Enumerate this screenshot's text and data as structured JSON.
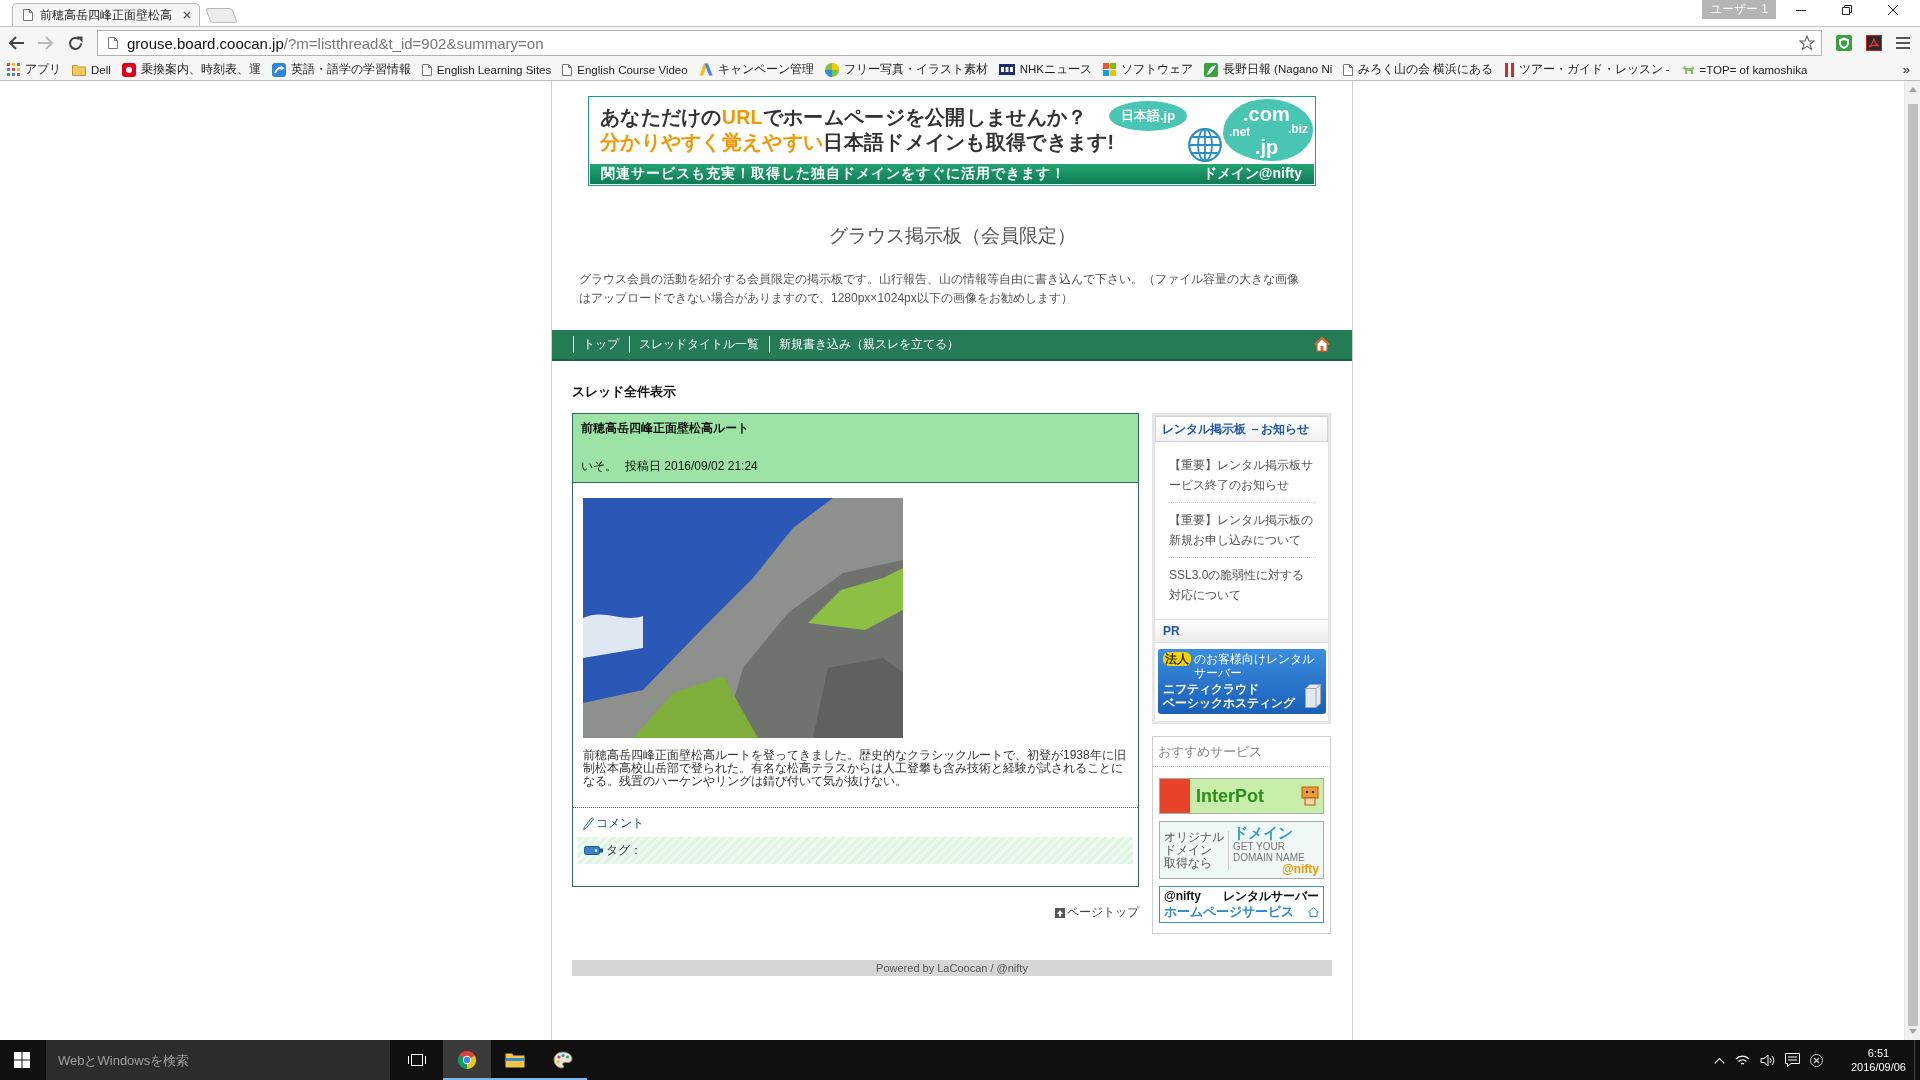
{
  "browser": {
    "tabs": [
      {
        "title": "前穂高岳四峰正面壁松高",
        "selected": true
      }
    ],
    "profile": "ユーザー 1",
    "address": {
      "host": "grouse.board.coocan.jp",
      "path": "/?m=listthread&t_id=902&summary=on"
    },
    "bookmarks": [
      {
        "label": "アプリ",
        "kind": "apps"
      },
      {
        "label": "Dell",
        "kind": "folder"
      },
      {
        "label": "乗換案内、時刻表、運",
        "kind": "yahoo"
      },
      {
        "label": "英語・語学の学習情報",
        "kind": "arrow"
      },
      {
        "label": "English Learning Sites",
        "kind": "page"
      },
      {
        "label": "English Course Video",
        "kind": "page"
      },
      {
        "label": "キャンペーン管理",
        "kind": "adwords"
      },
      {
        "label": "フリー写真・イラスト素材",
        "kind": "ball"
      },
      {
        "label": "NHKニュース",
        "kind": "nhk"
      },
      {
        "label": "ソフトウェア",
        "kind": "windows"
      },
      {
        "label": "長野日報 (Nagano Ni",
        "kind": "leaf"
      },
      {
        "label": "みろく山の会 横浜にある",
        "kind": "page"
      },
      {
        "label": "ツアー・ガイド・レッスン -",
        "kind": "bars"
      },
      {
        "label": "=TOP= of kamoshika",
        "kind": "goat"
      }
    ],
    "more_bookmarks": "»"
  },
  "page": {
    "banner": {
      "headline": [
        [
          {
            "text": "あなただけの",
            "color": "#333333"
          },
          {
            "text": "URL",
            "color": "#f39800"
          },
          {
            "text": "でホームページを公開しませんか？",
            "color": "#333333"
          }
        ],
        [
          {
            "text": "分かりやすく覚えやすい",
            "color": "#f39800"
          },
          {
            "text": "日本語ドメインも取得できます!",
            "color": "#333333"
          }
        ]
      ],
      "tagline": "関連サービスも充実！取得した独自ドメインをすぐに活用できます！",
      "brand": "ドメイン@nifty",
      "cloud_label": "日本語.jp",
      "domain_suffixes": [
        ".com",
        ".net",
        ".biz",
        ".jp"
      ]
    },
    "title": "グラウス掲示板（会員限定）",
    "description": "グラウス会員の活動を紹介する会員限定の掲示板です。山行報告、山の情報等自由に書き込んで下さい。（ファイル容量の大きな画像はアップロードできない場合がありますので、1280px×1024px以下の画像をお勧めします）",
    "nav": [
      {
        "label": "トップ"
      },
      {
        "label": "スレッドタイトル一覧"
      },
      {
        "label": "新規書き込み（親スレを立てる）"
      }
    ],
    "heading": "スレッド全件表示",
    "thread": {
      "title": "前穂高岳四峰正面壁松高ルート",
      "author": "いそ。",
      "posted": "投稿日 2016/09/02 21:24",
      "body": "前穂高岳四峰正面壁松高ルートを登ってきました。歴史的なクラシックルートで、初登が1938年に旧制松本高校山岳部で登られた。有名な松高テラスからは人工登攀も含み技術と経験が試されることになる。残置のハーケンやリングは錆び付いて気が抜けない。",
      "comment_link": "コメント",
      "tags_label": "タグ："
    },
    "page_top": "ページトップ",
    "sidebar": {
      "notices": {
        "title": "レンタル掲示板 －お知らせ",
        "items": [
          "【重要】レンタル掲示板サービス終了のお知らせ",
          "【重要】レンタル掲示板の新規お申し込みについて",
          "SSL3.0の脆弱性に対する対応について"
        ]
      },
      "pr": {
        "title": "PR",
        "ad": {
          "badge": "法人",
          "caption": "のお客様向けレンタルサーバー",
          "title_lines": [
            "ニフティクラウド",
            "ベーシックホスティング"
          ]
        }
      },
      "services": {
        "title": "おすすめサービス",
        "ads": [
          {
            "kind": "interpot",
            "title": "InterPot"
          },
          {
            "kind": "domain",
            "tagline": [
              "オリジナル",
              "ドメイン",
              "取得なら"
            ],
            "title": "ドメイン",
            "subtitle": "GET YOUR DOMAIN NAME",
            "brand": "@nifty"
          },
          {
            "kind": "homepage",
            "brand": "@nifty",
            "caption": "レンタルサーバー",
            "title": "ホームページサービス"
          }
        ]
      }
    },
    "footer": "Powered by LaCoocan / @nifty"
  },
  "taskbar": {
    "search": {
      "placeholder": "WebとWindowsを検索"
    },
    "apps": [
      {
        "kind": "chrome",
        "running": true,
        "active": true
      },
      {
        "kind": "explorer",
        "running": true,
        "active": false
      },
      {
        "kind": "paint",
        "running": true,
        "active": false
      }
    ],
    "clock": {
      "time": "6:51",
      "date": "2016/09/06"
    }
  }
}
